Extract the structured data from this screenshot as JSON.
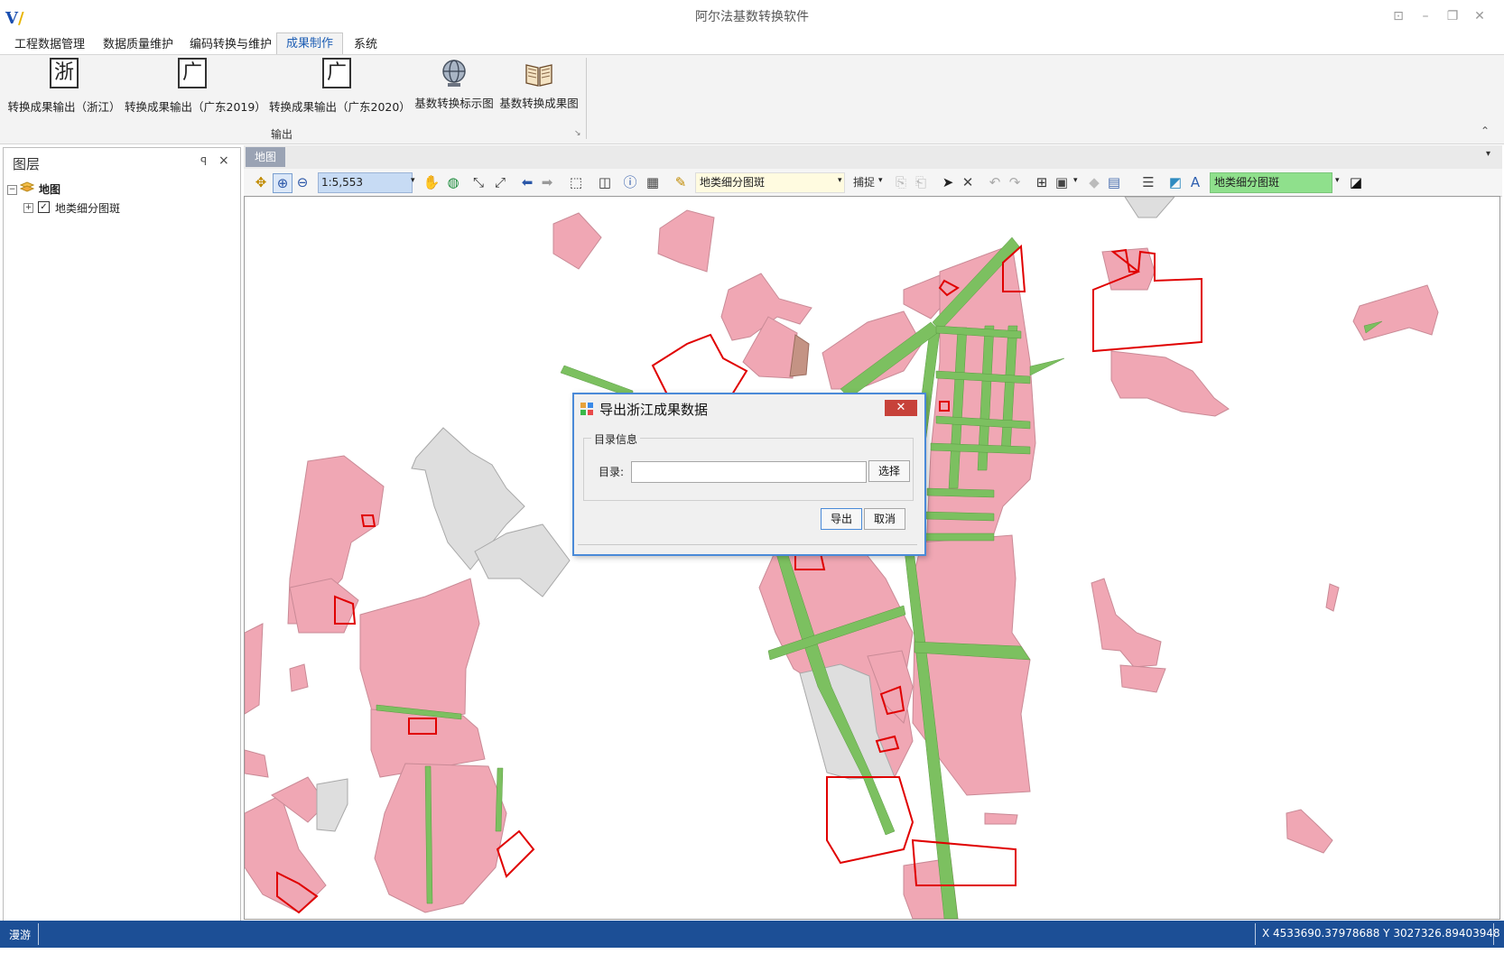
{
  "app": {
    "title": "阿尔法基数转换软件",
    "window_buttons": [
      "⊡",
      "–",
      "❐",
      "✕"
    ]
  },
  "menu": {
    "tabs": [
      "工程数据管理",
      "数据质量维护",
      "编码转换与维护",
      "成果制作",
      "系统"
    ],
    "active_tab": "成果制作"
  },
  "ribbon": {
    "buttons": [
      {
        "icon": "浙",
        "label": "转换成果输出（浙江）"
      },
      {
        "icon": "广",
        "label": "转换成果输出（广东2019）"
      },
      {
        "icon": "广",
        "label": "转换成果输出（广东2020）"
      },
      {
        "icon": "globe-icon",
        "label": "基数转换标示图"
      },
      {
        "icon": "book-icon",
        "label": "基数转换成果图"
      }
    ],
    "group_label": "输出"
  },
  "layer_panel": {
    "title": "图层",
    "pin": "ꟼ",
    "close": "×",
    "tree": [
      {
        "label": "地图",
        "expanded": true
      },
      {
        "label": "地类细分图斑",
        "checked": true
      }
    ]
  },
  "map": {
    "tab_label": "地图",
    "scale": "1:5,553",
    "layer_select": "地类细分图斑",
    "snap_label": "捕捉",
    "target_layer": "地类细分图斑",
    "colors": {
      "parcel_fill": "#f0a7b4",
      "parcel_stroke": "#c98a96",
      "road_fill": "#7cc060",
      "selected_stroke": "#e00000",
      "gray_fill": "#dedede",
      "brown_fill": "#c49384"
    }
  },
  "dialog": {
    "title": "导出浙江成果数据",
    "close_label": "✕",
    "group_label": "目录信息",
    "dir_label": "目录:",
    "dir_value": "",
    "select_button": "选择",
    "export_button": "导出",
    "cancel_button": "取消"
  },
  "status": {
    "mode": "漫游",
    "coords": "X 4533690.37978688 Y 3027326.89403948"
  }
}
